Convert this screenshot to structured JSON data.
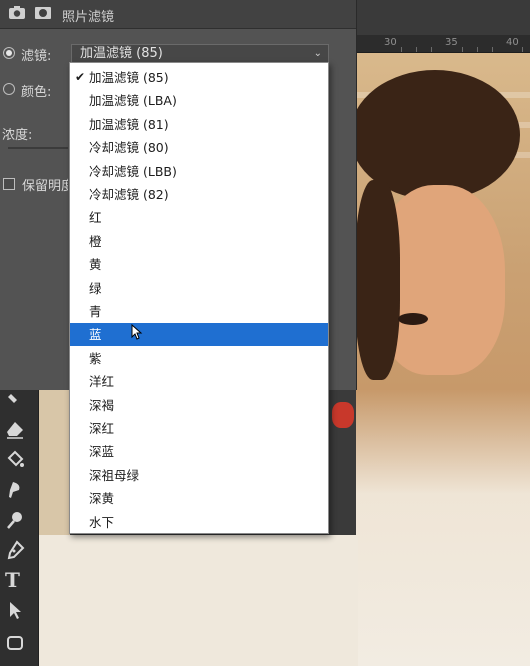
{
  "dialog": {
    "title": "照片滤镜",
    "icons": [
      "camera-adjustment-icon",
      "mask-icon"
    ],
    "filter_label": "滤镜:",
    "color_label": "颜色:",
    "density_label": "浓度:",
    "preserve_luminosity_label": "保留明度",
    "selected_filter": "加温滤镜 (85)"
  },
  "menu": {
    "items": [
      "加温滤镜 (85)",
      "加温滤镜 (LBA)",
      "加温滤镜 (81)",
      "冷却滤镜 (80)",
      "冷却滤镜 (LBB)",
      "冷却滤镜 (82)",
      "红",
      "橙",
      "黄",
      "绿",
      "青",
      "蓝",
      "紫",
      "洋红",
      "深褐",
      "深红",
      "深蓝",
      "深祖母绿",
      "深黄",
      "水下"
    ],
    "checked_index": 0,
    "highlighted_index": 11,
    "highlight_color": "#1f6fd1"
  },
  "ruler": {
    "labels": [
      "30",
      "35",
      "40"
    ]
  },
  "toolbar": {
    "tools": [
      "brush-icon",
      "eraser-icon",
      "paint-bucket-icon",
      "smudge-icon",
      "dodge-icon",
      "pen-icon",
      "type-tool-icon",
      "path-selection-icon",
      "rectangle-icon"
    ],
    "type_glyph": "T"
  }
}
